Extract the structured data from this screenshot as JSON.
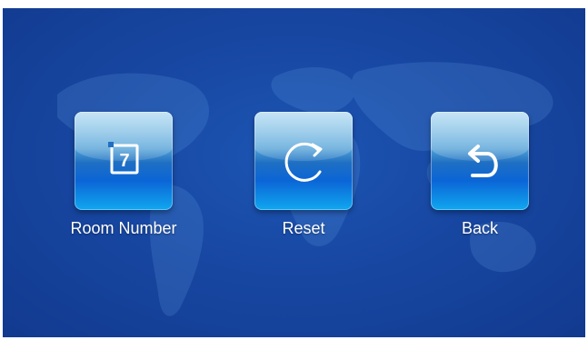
{
  "screen": {
    "background_color": "#1747a2"
  },
  "tiles": [
    {
      "label": "Room Number",
      "icon": "room-number-icon",
      "glyph": "7"
    },
    {
      "label": "Reset",
      "icon": "reset-icon"
    },
    {
      "label": "Back",
      "icon": "back-icon"
    }
  ]
}
